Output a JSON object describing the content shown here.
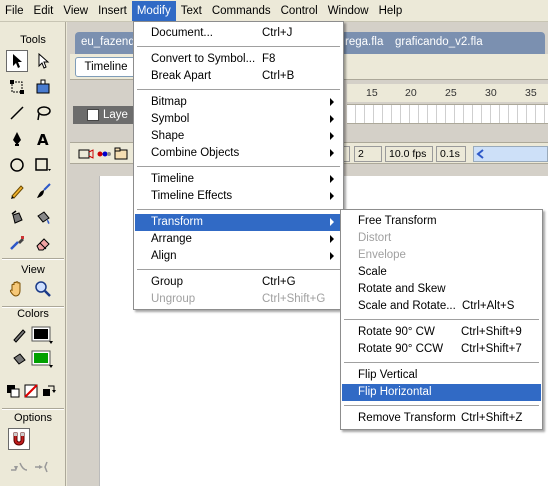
{
  "menubar": {
    "items": [
      "File",
      "Edit",
      "View",
      "Insert",
      "Modify",
      "Text",
      "Commands",
      "Control",
      "Window",
      "Help"
    ],
    "active": "Modify"
  },
  "tools": {
    "tools_title": "Tools",
    "view_title": "View",
    "colors_title": "Colors",
    "options_title": "Options",
    "icons": [
      "arrow-icon",
      "subselect-icon",
      "free-transform-icon",
      "fill-transform-icon",
      "line-icon",
      "lasso-icon",
      "pen-icon",
      "text-icon",
      "oval-icon",
      "rectangle-icon",
      "pencil-icon",
      "brush-icon",
      "ink-bottle-icon",
      "paint-bucket-icon",
      "eyedropper-icon",
      "eraser-icon",
      "hand-icon",
      "zoom-icon",
      "stroke-color-icon",
      "fill-color-icon",
      "black-white-icon",
      "no-color-icon",
      "swap-colors-icon",
      "snap-magnet-icon",
      "smooth-icon",
      "straighten-icon"
    ]
  },
  "doc": {
    "tabs": [
      "eu_fazend",
      "rega.fla",
      "graficando_v2.fla"
    ],
    "timeline_button": "Timeline",
    "layer_label": "Laye",
    "ruler": [
      "15",
      "20",
      "25",
      "30",
      "35"
    ],
    "status": {
      "frame": "2",
      "fps": "10.0 fps",
      "time": "0.1s"
    }
  },
  "modify_menu": {
    "items": [
      {
        "label": "Document...",
        "shortcut": "Ctrl+J"
      },
      {
        "label": "Convert to Symbol...",
        "shortcut": "F8"
      },
      {
        "label": "Break Apart",
        "shortcut": "Ctrl+B"
      },
      {
        "label": "Bitmap"
      },
      {
        "label": "Symbol"
      },
      {
        "label": "Shape"
      },
      {
        "label": "Combine Objects"
      },
      {
        "label": "Timeline"
      },
      {
        "label": "Timeline Effects"
      },
      {
        "label": "Transform"
      },
      {
        "label": "Arrange"
      },
      {
        "label": "Align"
      },
      {
        "label": "Group",
        "shortcut": "Ctrl+G"
      },
      {
        "label": "Ungroup",
        "shortcut": "Ctrl+Shift+G"
      }
    ]
  },
  "transform_menu": {
    "items": [
      {
        "label": "Free Transform",
        "shortcut": ""
      },
      {
        "label": "Distort",
        "shortcut": ""
      },
      {
        "label": "Envelope",
        "shortcut": ""
      },
      {
        "label": "Scale",
        "shortcut": ""
      },
      {
        "label": "Rotate and Skew",
        "shortcut": ""
      },
      {
        "label": "Scale and Rotate...",
        "shortcut": "Ctrl+Alt+S"
      },
      {
        "label": "Rotate 90° CW",
        "shortcut": "Ctrl+Shift+9"
      },
      {
        "label": "Rotate 90° CCW",
        "shortcut": "Ctrl+Shift+7"
      },
      {
        "label": "Flip Vertical",
        "shortcut": ""
      },
      {
        "label": "Flip Horizontal",
        "shortcut": ""
      },
      {
        "label": "Remove Transform",
        "shortcut": "Ctrl+Shift+Z"
      }
    ]
  },
  "colors": {
    "highlight": "#316ac5",
    "panel": "#ece9d8",
    "stroke": "#000000",
    "fill": "#00a000"
  }
}
